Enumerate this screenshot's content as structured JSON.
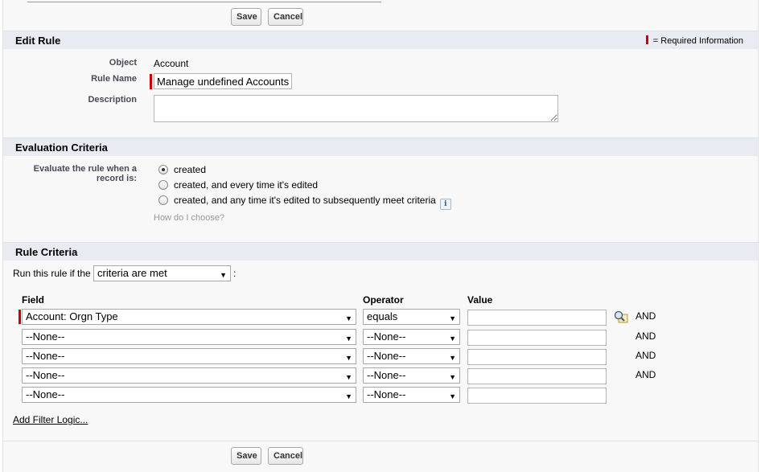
{
  "buttons": {
    "save": "Save",
    "cancel": "Cancel"
  },
  "edit_rule": {
    "title": "Edit Rule",
    "required_legend": "= Required Information",
    "object_label": "Object",
    "object_value": "Account",
    "rule_name_label": "Rule Name",
    "rule_name_value": "Manage undefined Accounts",
    "description_label": "Description",
    "description_value": ""
  },
  "evaluation": {
    "title": "Evaluation Criteria",
    "prompt_line1": "Evaluate the rule when a",
    "prompt_line2": "record is:",
    "options": [
      {
        "label": "created",
        "checked": true
      },
      {
        "label": "created, and every time it's edited",
        "checked": false
      },
      {
        "label": "created, and any time it's edited to subsequently meet criteria",
        "checked": false
      }
    ],
    "info_icon": "i",
    "help_link": "How do I choose?"
  },
  "rule_criteria": {
    "title": "Rule Criteria",
    "run_label": "Run this rule if the",
    "run_select": "criteria are met",
    "run_suffix": ":",
    "columns": {
      "field": "Field",
      "operator": "Operator",
      "value": "Value"
    },
    "rows": [
      {
        "field": "Account: Orgn Type",
        "operator": "equals",
        "value": "",
        "conj": "AND"
      },
      {
        "field": "--None--",
        "operator": "--None--",
        "value": "",
        "conj": "AND"
      },
      {
        "field": "--None--",
        "operator": "--None--",
        "value": "",
        "conj": "AND"
      },
      {
        "field": "--None--",
        "operator": "--None--",
        "value": "",
        "conj": "AND"
      },
      {
        "field": "--None--",
        "operator": "--None--",
        "value": "",
        "conj": ""
      }
    ],
    "add_filter_logic": "Add Filter Logic..."
  },
  "colors": {
    "section_bg": "#e8ebf2",
    "required": "#cc0000",
    "page_bg": "#f8f8f8"
  }
}
